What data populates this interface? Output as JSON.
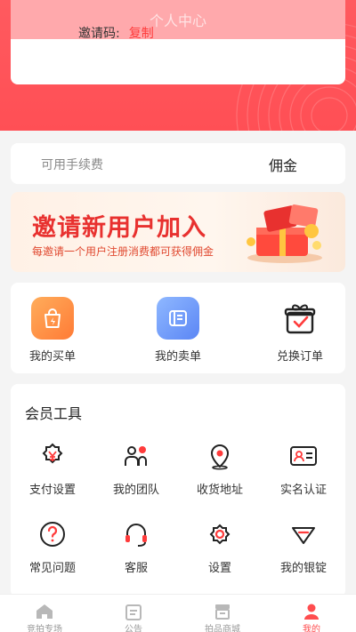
{
  "header": {
    "title": "个人中心",
    "invite_label": "邀请码:",
    "copy_label": "复制"
  },
  "fee": {
    "label": "可用手续费",
    "value": "佣金"
  },
  "banner": {
    "headline": "邀请新用户加入",
    "sub": "每邀请一个用户注册消费都可获得佣金"
  },
  "orders": [
    {
      "label": "我的买单",
      "icon": "shopping-bag-icon"
    },
    {
      "label": "我的卖单",
      "icon": "ledger-icon"
    },
    {
      "label": "兑换订单",
      "icon": "gift-box-icon"
    }
  ],
  "tools": {
    "title": "会员工具",
    "items": [
      {
        "label": "支付设置",
        "icon": "yuan-gear-icon"
      },
      {
        "label": "我的团队",
        "icon": "team-icon"
      },
      {
        "label": "收货地址",
        "icon": "location-pin-icon"
      },
      {
        "label": "实名认证",
        "icon": "id-card-icon"
      },
      {
        "label": "常见问题",
        "icon": "question-icon"
      },
      {
        "label": "客服",
        "icon": "headset-icon"
      },
      {
        "label": "设置",
        "icon": "settings-icon"
      },
      {
        "label": "我的银锭",
        "icon": "silver-ingot-icon"
      }
    ]
  },
  "tabs": [
    {
      "label": "竞拍专场",
      "icon": "home-icon",
      "active": false
    },
    {
      "label": "公告",
      "icon": "notice-icon",
      "active": false
    },
    {
      "label": "拍品商城",
      "icon": "shop-icon",
      "active": false
    },
    {
      "label": "我的",
      "icon": "user-icon",
      "active": true
    }
  ],
  "colors": {
    "brand": "#ff4f55",
    "accent_red": "#ff3b3b",
    "banner_text": "#e8312f",
    "tab_active": "#ff4d4f"
  }
}
